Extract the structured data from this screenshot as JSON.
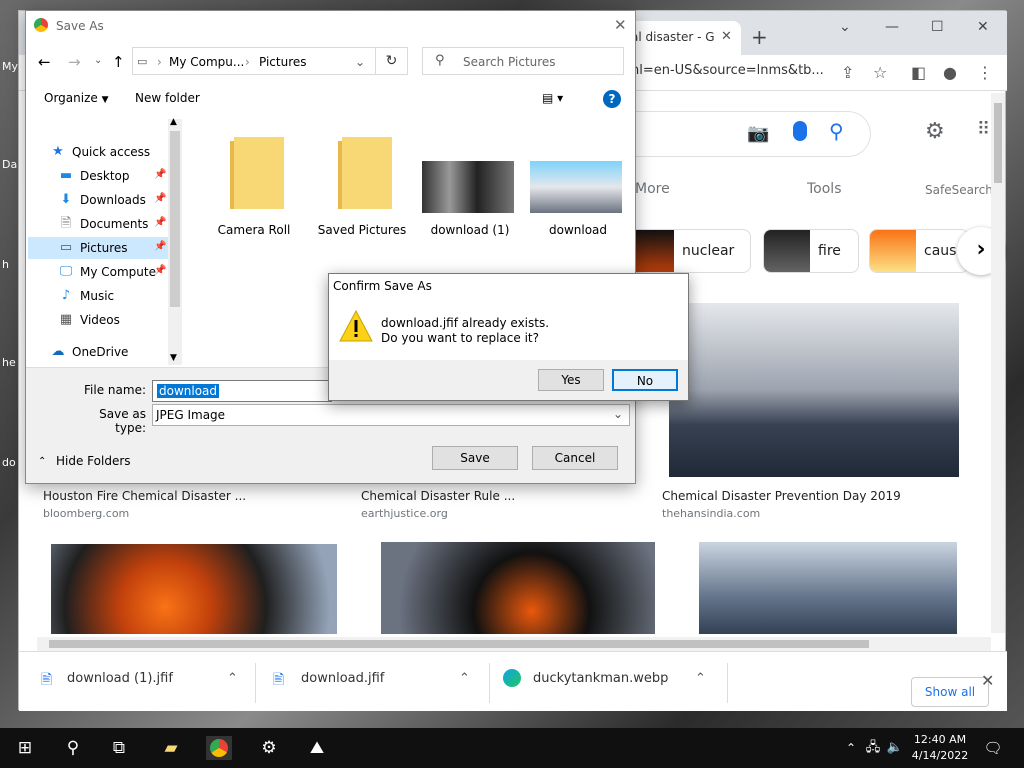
{
  "desktop": {
    "labels": [
      "My",
      "Da",
      "h",
      "he",
      "do"
    ]
  },
  "browser": {
    "tab_title": "al disaster - G",
    "url": "hl=en-US&source=lnms&tb...",
    "nav": {
      "more": "More",
      "tools": "Tools",
      "safesearch": "SafeSearch"
    },
    "chips": [
      {
        "label": "nuclear"
      },
      {
        "label": "fire"
      },
      {
        "label": "caus"
      }
    ],
    "results": [
      {
        "title": "Houston Fire Chemical Disaster ...",
        "source": "bloomberg.com"
      },
      {
        "title": "Chemical Disaster Rule ...",
        "source": "earthjustice.org"
      },
      {
        "title": "Chemical Disaster Prevention Day 2019",
        "source": "thehansindia.com"
      }
    ],
    "downloads": [
      {
        "name": "download (1).jfif"
      },
      {
        "name": "download.jfif"
      },
      {
        "name": "duckytankman.webp"
      }
    ],
    "show_all": "Show all"
  },
  "save_dialog": {
    "title": "Save As",
    "breadcrumb": [
      "My Compu...",
      "Pictures"
    ],
    "search_placeholder": "Search Pictures",
    "organize": "Organize",
    "new_folder": "New folder",
    "nav_items": [
      {
        "label": "Quick access"
      },
      {
        "label": "Desktop"
      },
      {
        "label": "Downloads"
      },
      {
        "label": "Documents"
      },
      {
        "label": "Pictures"
      },
      {
        "label": "My Compute"
      },
      {
        "label": "Music"
      },
      {
        "label": "Videos"
      },
      {
        "label": "OneDrive"
      }
    ],
    "files": [
      {
        "name": "Camera Roll"
      },
      {
        "name": "Saved Pictures"
      },
      {
        "name": "download (1)"
      },
      {
        "name": "download"
      }
    ],
    "file_name_label": "File name:",
    "file_name_value": "download",
    "save_type_label": "Save as type:",
    "save_type_value": "JPEG Image",
    "hide_folders": "Hide Folders",
    "save": "Save",
    "cancel": "Cancel"
  },
  "confirm_dialog": {
    "title": "Confirm Save As",
    "line1": "download.jfif already exists.",
    "line2": "Do you want to replace it?",
    "yes": "Yes",
    "no": "No"
  },
  "taskbar": {
    "time": "12:40 AM",
    "date": "4/14/2022"
  }
}
